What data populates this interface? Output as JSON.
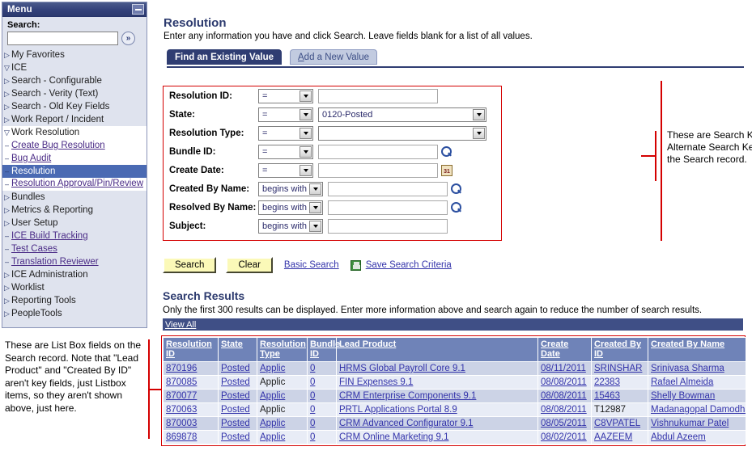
{
  "sidebar": {
    "header_title": "Menu",
    "minimize_icon": "minimize-icon",
    "search_label": "Search:",
    "search_value": "",
    "search_placeholder": "",
    "search_go_icon": "double-chevron-right-icon",
    "items": [
      {
        "label": "My Favorites",
        "marker": "collapsed",
        "indent": 0,
        "link": false,
        "selected": false,
        "white": false
      },
      {
        "label": "ICE",
        "marker": "expanded",
        "indent": 0,
        "link": false,
        "selected": false,
        "white": false
      },
      {
        "label": "Search - Configurable",
        "marker": "collapsed",
        "indent": 1,
        "link": false,
        "selected": false,
        "white": false
      },
      {
        "label": "Search - Verity (Text)",
        "marker": "collapsed",
        "indent": 1,
        "link": false,
        "selected": false,
        "white": false
      },
      {
        "label": "Search - Old Key Fields",
        "marker": "collapsed",
        "indent": 1,
        "link": false,
        "selected": false,
        "white": false
      },
      {
        "label": "Work Report / Incident",
        "marker": "collapsed",
        "indent": 1,
        "link": false,
        "selected": false,
        "white": false
      },
      {
        "label": "Work Resolution",
        "marker": "expanded",
        "indent": 1,
        "link": false,
        "selected": false,
        "white": true
      },
      {
        "label": "Create Bug Resolution",
        "marker": "leaf",
        "indent": 2,
        "link": true,
        "selected": false,
        "white": true
      },
      {
        "label": "Bug Audit",
        "marker": "leaf",
        "indent": 2,
        "link": true,
        "selected": false,
        "white": true
      },
      {
        "label": "Resolution",
        "marker": "leaf",
        "indent": 2,
        "link": false,
        "selected": true,
        "white": false
      },
      {
        "label": "Resolution Approval/Pin/Review",
        "marker": "leaf",
        "indent": 2,
        "link": true,
        "selected": false,
        "white": true,
        "wrap": true
      },
      {
        "label": "Bundles",
        "marker": "collapsed",
        "indent": 1,
        "link": false,
        "selected": false,
        "white": false
      },
      {
        "label": "Metrics & Reporting",
        "marker": "collapsed",
        "indent": 1,
        "link": false,
        "selected": false,
        "white": false
      },
      {
        "label": "User Setup",
        "marker": "collapsed",
        "indent": 1,
        "link": false,
        "selected": false,
        "white": false
      },
      {
        "label": "ICE Build Tracking",
        "marker": "leaf",
        "indent": 1,
        "link": true,
        "selected": false,
        "white": false
      },
      {
        "label": "Test Cases",
        "marker": "leaf",
        "indent": 1,
        "link": true,
        "selected": false,
        "white": false
      },
      {
        "label": "Translation Reviewer",
        "marker": "leaf",
        "indent": 1,
        "link": true,
        "selected": false,
        "white": false
      },
      {
        "label": "ICE Administration",
        "marker": "collapsed",
        "indent": 0,
        "link": false,
        "selected": false,
        "white": false
      },
      {
        "label": "Worklist",
        "marker": "collapsed",
        "indent": 0,
        "link": false,
        "selected": false,
        "white": false
      },
      {
        "label": "Reporting Tools",
        "marker": "collapsed",
        "indent": 0,
        "link": false,
        "selected": false,
        "white": false
      },
      {
        "label": "PeopleTools",
        "marker": "collapsed",
        "indent": 0,
        "link": false,
        "selected": false,
        "white": false
      }
    ]
  },
  "page": {
    "title": "Resolution",
    "description": "Enter any information you have and click Search. Leave fields blank for a list of all values."
  },
  "tabs": {
    "active_label": "Find an Existing Value",
    "inactive_label_prefix": "A",
    "inactive_label_rest": "dd a New Value"
  },
  "criteria": {
    "rows": [
      {
        "label": "Resolution ID:",
        "operator": "=",
        "op_wide": false,
        "value": "",
        "control": "text",
        "input_width": 148,
        "accessory": "none"
      },
      {
        "label": "State:",
        "operator": "=",
        "op_wide": false,
        "value": "0120-Posted",
        "control": "select",
        "input_width": 208,
        "accessory": "none"
      },
      {
        "label": "Resolution Type:",
        "operator": "=",
        "op_wide": false,
        "value": "",
        "control": "select",
        "input_width": 208,
        "accessory": "none"
      },
      {
        "label": "Bundle ID:",
        "operator": "=",
        "op_wide": false,
        "value": "",
        "control": "text",
        "input_width": 148,
        "accessory": "lookup"
      },
      {
        "label": "Create Date:",
        "operator": "=",
        "op_wide": false,
        "value": "",
        "control": "text",
        "input_width": 148,
        "accessory": "calendar"
      },
      {
        "label": "Created By Name:",
        "operator": "begins with",
        "op_wide": true,
        "value": "",
        "control": "text",
        "input_width": 148,
        "accessory": "lookup"
      },
      {
        "label": "Resolved By Name:",
        "operator": "begins with",
        "op_wide": true,
        "value": "",
        "control": "text",
        "input_width": 148,
        "accessory": "lookup"
      },
      {
        "label": "Subject:",
        "operator": "begins with",
        "op_wide": true,
        "value": "",
        "control": "text",
        "input_width": 148,
        "accessory": "none"
      }
    ]
  },
  "actions": {
    "search_label": "Search",
    "clear_label": "Clear",
    "basic_search_label": "Basic Search",
    "save_icon": "floppy-disk-icon",
    "save_search_label": "Save Search Criteria"
  },
  "results": {
    "title": "Search Results",
    "note": "Only the first 300 results can be displayed. Enter more information above and search again to reduce the number of search results.",
    "view_all_label": "View All",
    "columns": [
      "Resolution ID",
      "State",
      "Resolution Type",
      "Bundle ID",
      "Lead Product",
      "Create Date",
      "Created By ID",
      "Created By Name"
    ],
    "rows": [
      {
        "resolution_id": "870196",
        "state": "Posted",
        "resolution_type": "Applic",
        "bundle_id": "0",
        "lead_product": "HRMS Global Payroll Core 9.1",
        "create_date": "08/11/2011",
        "created_by_id": "SRINSHAR",
        "created_by_name": "Srinivasa Sharma",
        "state_is_link": true,
        "type_is_link": true,
        "id_is_link": true,
        "cbid_is_link": true
      },
      {
        "resolution_id": "870085",
        "state": "Posted",
        "resolution_type": "Applic",
        "bundle_id": "0",
        "lead_product": "FIN Expenses 9.1",
        "create_date": "08/08/2011",
        "created_by_id": "22383",
        "created_by_name": "Rafael Almeida",
        "state_is_link": true,
        "type_is_link": false,
        "id_is_link": true,
        "cbid_is_link": true
      },
      {
        "resolution_id": "870077",
        "state": "Posted",
        "resolution_type": "Applic",
        "bundle_id": "0",
        "lead_product": "CRM Enterprise Components 9.1",
        "create_date": "08/08/2011",
        "created_by_id": "15463",
        "created_by_name": "Shelly Bowman",
        "state_is_link": true,
        "type_is_link": true,
        "id_is_link": true,
        "cbid_is_link": true
      },
      {
        "resolution_id": "870063",
        "state": "Posted",
        "resolution_type": "Applic",
        "bundle_id": "0",
        "lead_product": "PRTL Applications Portal 8.9",
        "create_date": "08/08/2011",
        "created_by_id": "T12987",
        "created_by_name": "Madanagopal Damodharan",
        "state_is_link": true,
        "type_is_link": false,
        "id_is_link": true,
        "cbid_is_link": false
      },
      {
        "resolution_id": "870003",
        "state": "Posted",
        "resolution_type": "Applic",
        "bundle_id": "0",
        "lead_product": "CRM Advanced Configurator 9.1",
        "create_date": "08/05/2011",
        "created_by_id": "C8VPATEL",
        "created_by_name": "Vishnukumar Patel",
        "state_is_link": true,
        "type_is_link": true,
        "id_is_link": true,
        "cbid_is_link": true
      },
      {
        "resolution_id": "869878",
        "state": "Posted",
        "resolution_type": "Applic",
        "bundle_id": "0",
        "lead_product": "CRM Online Marketing 9.1",
        "create_date": "08/02/2011",
        "created_by_id": "AAZEEM",
        "created_by_name": "Abdul Azeem",
        "state_is_link": true,
        "type_is_link": true,
        "id_is_link": true,
        "cbid_is_link": true
      }
    ]
  },
  "annotations": {
    "right": "These are Search Key and Alternate Search Key fields on the Search record.",
    "left": "These are List Box fields on the Search record. Note that \"Lead Product\" and \"Created By ID\" aren't key fields, just Listbox items, so they aren't shown above, just here."
  },
  "colors": {
    "header_navy": "#2c3a6e",
    "selected_blue": "#4a6ab3",
    "annotation_red": "#d40000",
    "button_yellow": "#fbf9b8",
    "link_blue": "#3333aa",
    "table_header_blue": "#6f83b8"
  }
}
